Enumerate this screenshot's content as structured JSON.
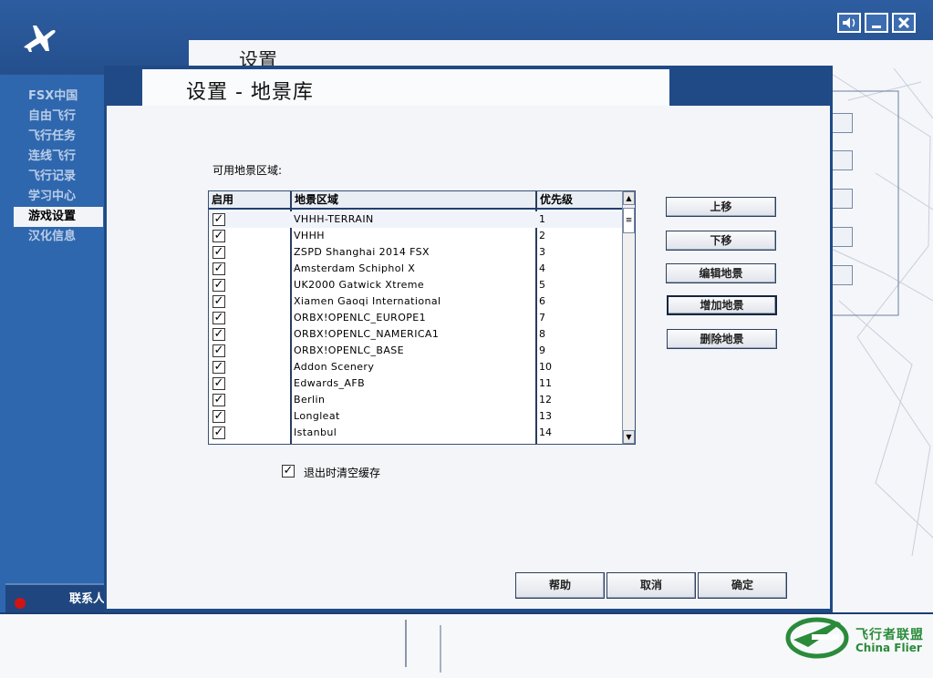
{
  "topbar": {
    "logo_icon": "airplane-icon",
    "buttons": [
      {
        "name": "sound",
        "glyph": "🔊"
      },
      {
        "name": "minimize",
        "glyph": "_"
      },
      {
        "name": "close",
        "glyph": "✕"
      }
    ]
  },
  "background_window": {
    "title": "设置"
  },
  "sidebar": {
    "items": [
      {
        "label": "FSX中国",
        "active": false
      },
      {
        "label": "自由飞行",
        "active": false
      },
      {
        "label": "飞行任务",
        "active": false
      },
      {
        "label": "连线飞行",
        "active": false
      },
      {
        "label": "飞行记录",
        "active": false
      },
      {
        "label": "学习中心",
        "active": false
      },
      {
        "label": "游戏设置",
        "active": true
      },
      {
        "label": "汉化信息",
        "active": false
      }
    ],
    "contact_label": "联系人"
  },
  "dialog": {
    "title": "设置 - 地景库",
    "available_label": "可用地景区域:",
    "columns": {
      "enabled": "启用",
      "area": "地景区域",
      "priority": "优先级"
    },
    "rows": [
      {
        "checked": true,
        "name": "VHHH-TERRAIN",
        "priority": "1"
      },
      {
        "checked": true,
        "name": "VHHH",
        "priority": "2"
      },
      {
        "checked": true,
        "name": "ZSPD Shanghai 2014 FSX",
        "priority": "3"
      },
      {
        "checked": true,
        "name": "Amsterdam Schiphol X",
        "priority": "4"
      },
      {
        "checked": true,
        "name": "UK2000 Gatwick Xtreme",
        "priority": "5"
      },
      {
        "checked": true,
        "name": "Xiamen Gaoqi International",
        "priority": "6"
      },
      {
        "checked": true,
        "name": "ORBX!OPENLC_EUROPE1",
        "priority": "7"
      },
      {
        "checked": true,
        "name": "ORBX!OPENLC_NAMERICA1",
        "priority": "8"
      },
      {
        "checked": true,
        "name": "ORBX!OPENLC_BASE",
        "priority": "9"
      },
      {
        "checked": true,
        "name": "Addon Scenery",
        "priority": "10"
      },
      {
        "checked": true,
        "name": "Edwards_AFB",
        "priority": "11"
      },
      {
        "checked": true,
        "name": "Berlin",
        "priority": "12"
      },
      {
        "checked": true,
        "name": "Longleat",
        "priority": "13"
      },
      {
        "checked": true,
        "name": "Istanbul",
        "priority": "14"
      }
    ],
    "side_buttons": {
      "move_up": "上移",
      "move_down": "下移",
      "edit": "编辑地景",
      "add": "增加地景",
      "delete": "删除地景"
    },
    "clear_cache_label": "退出时清空缓存",
    "clear_cache_checked": true,
    "footer_buttons": {
      "help": "帮助",
      "cancel": "取消",
      "ok": "确定"
    }
  },
  "brand": {
    "cn": "飞行者联盟",
    "en": "China Flier"
  }
}
